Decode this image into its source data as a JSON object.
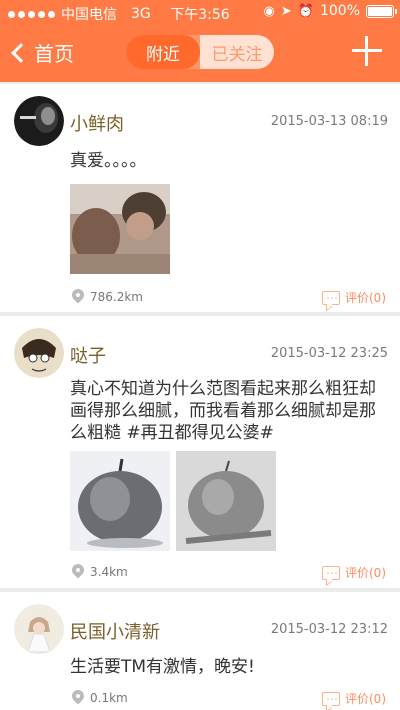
{
  "status_bar": {
    "carrier": "中国电信",
    "network": "3G",
    "time": "下午3:56",
    "battery": "100%"
  },
  "nav": {
    "back_label": "首页",
    "tabs": [
      {
        "label": "附近",
        "active": true
      },
      {
        "label": "已关注",
        "active": false
      }
    ]
  },
  "posts": [
    {
      "name": "小鲜肉",
      "time": "2015-03-13 08:19",
      "text": "真爱。。。。",
      "distance": "786.2km",
      "comment": "评价(0)"
    },
    {
      "name": "哒子",
      "time": "2015-03-12 23:25",
      "text": "真心不知道为什么范图看起来那么粗狂却画得那么细腻，而我看着那么细腻却是那么粗糙 #再丑都得见公婆#",
      "distance": "3.4km",
      "comment": "评价(0)"
    },
    {
      "name": "民国小清新",
      "time": "2015-03-12 23:12",
      "text": "生活要TM有激情，晚安!",
      "distance": "0.1km",
      "comment": "评价(0)"
    }
  ],
  "colors": {
    "accent": "#ff7a45",
    "name_text": "#7a5f2a",
    "comment_text": "#ff8c5e"
  }
}
